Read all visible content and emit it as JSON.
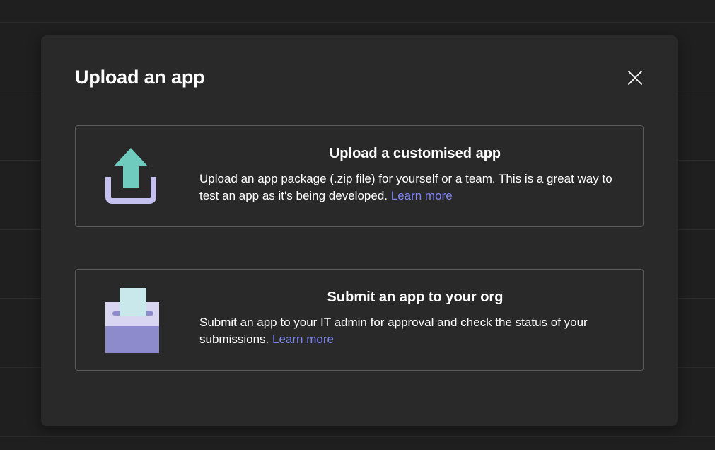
{
  "dialog": {
    "title": "Upload an app",
    "close_icon": "close-icon"
  },
  "options": [
    {
      "icon": "upload-icon",
      "title": "Upload a customised app",
      "description": "Upload an app package (.zip file) for yourself or a team. This is a great way to test an app as it's being developed.",
      "link_text": "Learn more"
    },
    {
      "icon": "submit-to-org-icon",
      "title": "Submit an app to your org",
      "description": "Submit an app to your IT admin for approval and check the status of your submissions.",
      "link_text": "Learn more"
    }
  ],
  "colors": {
    "background": "#1f1f1f",
    "dialog": "#292929",
    "card_border": "#5c5c5c",
    "link": "#7f85f5",
    "upload_arrow": "#6fcbbd",
    "upload_tray": "#c5c1ee",
    "box_top": "#d9d6f2",
    "box_bottom": "#8e8bcc",
    "paper": "#c8e8ec"
  }
}
